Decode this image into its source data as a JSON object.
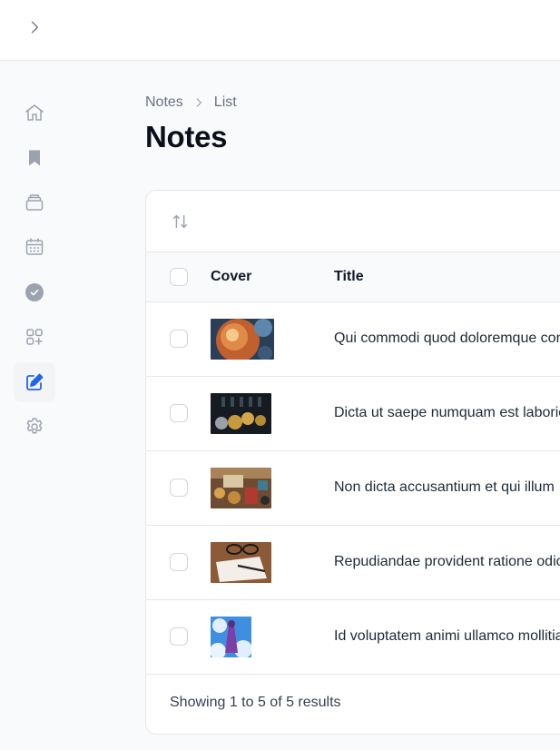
{
  "topbar": {
    "expand_icon": "chevron-right-icon"
  },
  "sidebar": {
    "items": [
      {
        "icon": "home-icon",
        "active": false
      },
      {
        "icon": "bookmark-icon",
        "active": false
      },
      {
        "icon": "collection-icon",
        "active": false
      },
      {
        "icon": "calendar-icon",
        "active": false
      },
      {
        "icon": "check-circle-icon",
        "active": false
      },
      {
        "icon": "apps-add-icon",
        "active": false
      },
      {
        "icon": "pencil-square-icon",
        "active": true
      },
      {
        "icon": "gear-icon",
        "active": false
      }
    ]
  },
  "breadcrumb": {
    "root": "Notes",
    "current": "List"
  },
  "page": {
    "title": "Notes"
  },
  "table": {
    "columns": {
      "cover": "Cover",
      "title": "Title"
    },
    "rows": [
      {
        "title": "Qui commodi quod doloremque consequatur",
        "cover": "nebula"
      },
      {
        "title": "Dicta ut saepe numquam est laboriosam",
        "cover": "coins"
      },
      {
        "title": "Non dicta accusantium et qui illum",
        "cover": "money-desk"
      },
      {
        "title": "Repudiandae provident ratione odio",
        "cover": "glasses-notebook"
      },
      {
        "title": "Id voluptatem animi ullamco mollitia",
        "cover": "anime-sky"
      }
    ],
    "footer": "Showing 1 to 5 of 5 results"
  },
  "colors": {
    "accent": "#2563eb",
    "icon_muted": "#9ca3af",
    "border": "#e5e7eb"
  }
}
